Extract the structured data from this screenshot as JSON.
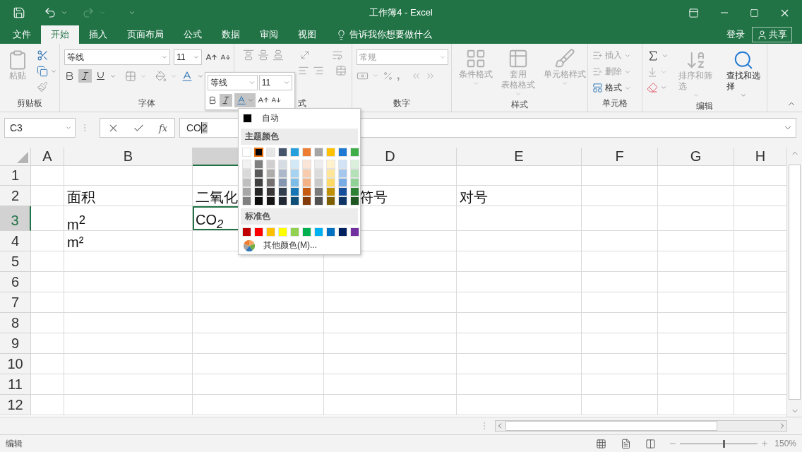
{
  "title_bar": {
    "title": "工作簿4 - Excel"
  },
  "menu_tabs": [
    {
      "label": "文件",
      "selected": false
    },
    {
      "label": "开始",
      "selected": true
    },
    {
      "label": "插入",
      "selected": false
    },
    {
      "label": "页面布局",
      "selected": false
    },
    {
      "label": "公式",
      "selected": false
    },
    {
      "label": "数据",
      "selected": false
    },
    {
      "label": "审阅",
      "selected": false
    },
    {
      "label": "视图",
      "selected": false
    }
  ],
  "tell_me": "告诉我你想要做什么",
  "account": {
    "sign_in": "登录",
    "share": "共享"
  },
  "ribbon": {
    "clipboard": {
      "paste": "粘贴",
      "label": "剪贴板"
    },
    "font": {
      "font_name": "等线",
      "font_size": "11",
      "italic_pressed": true,
      "label": "字体"
    },
    "alignment": {
      "label": "式",
      "disabled": true
    },
    "number": {
      "format": "常规",
      "comma": ",",
      "label": "数字",
      "disabled": true
    },
    "styles": {
      "items": [
        {
          "lines": [
            "条件格式"
          ],
          "disabled": true
        },
        {
          "lines": [
            "套用",
            "表格格式"
          ],
          "disabled": true
        },
        {
          "lines": [
            "单元格样式"
          ],
          "disabled": true
        }
      ],
      "label": "样式"
    },
    "cells": {
      "items": [
        {
          "label": "插入",
          "disabled": true
        },
        {
          "label": "删除",
          "disabled": true
        },
        {
          "label": "格式",
          "disabled": false
        }
      ],
      "label": "单元格"
    },
    "editing": {
      "sort": {
        "label": "排序和筛选",
        "disabled": true
      },
      "find": {
        "label": "查找和选择",
        "disabled": false
      },
      "label": "编辑"
    }
  },
  "formula_bar": {
    "name_box": "C3",
    "function_symbol": "fx",
    "value": "CO",
    "selected_text": "2"
  },
  "sheet": {
    "columns": [
      {
        "label": "A",
        "selected": false
      },
      {
        "label": "B",
        "selected": false
      },
      {
        "selected": true
      },
      {
        "label": "D",
        "selected": false
      },
      {
        "label": "E",
        "selected": false
      },
      {
        "label": "F",
        "selected": false
      },
      {
        "label": "G",
        "selected": false
      },
      {
        "label": "H",
        "selected": false
      }
    ],
    "rows": [
      {
        "label": "1",
        "selected": false,
        "cells": [
          {
            "selected": false
          },
          {
            "selected": false
          },
          {
            "selected": false
          },
          {
            "selected": false
          },
          {
            "selected": false
          },
          {
            "selected": false
          },
          {
            "selected": false
          },
          {
            "selected": false
          }
        ]
      },
      {
        "label": "2",
        "selected": false,
        "cells": [
          {
            "selected": false
          },
          {
            "text": "面积",
            "selected": false
          },
          {
            "text": "二氧化",
            "selected": false
          },
          {
            "text": "符号",
            "selected": false
          },
          {
            "text": "对号",
            "selected": false
          },
          {
            "selected": false
          },
          {
            "selected": false
          },
          {
            "selected": false
          }
        ]
      },
      {
        "label": "3",
        "selected": true,
        "cells": [
          {
            "selected": false
          },
          {
            "text": "m$^{2}$",
            "selected": false
          },
          {
            "text": "CO$_{2}$",
            "selected": true
          },
          {
            "selected": false
          },
          {
            "selected": false
          },
          {
            "selected": false
          },
          {
            "selected": false
          },
          {
            "selected": false
          }
        ]
      },
      {
        "label": "4",
        "selected": false,
        "cells": [
          {
            "selected": false
          },
          {
            "text": "m²",
            "selected": false
          },
          {
            "selected": false
          },
          {
            "selected": false
          },
          {
            "selected": false
          },
          {
            "selected": false
          },
          {
            "selected": false
          },
          {
            "selected": false
          }
        ]
      },
      {
        "label": "5",
        "selected": false,
        "cells": [
          {
            "selected": false
          },
          {
            "selected": false
          },
          {
            "selected": false
          },
          {
            "selected": false
          },
          {
            "selected": false
          },
          {
            "selected": false
          },
          {
            "selected": false
          },
          {
            "selected": false
          }
        ]
      },
      {
        "label": "6",
        "selected": false,
        "cells": [
          {
            "selected": false
          },
          {
            "selected": false
          },
          {
            "selected": false
          },
          {
            "selected": false
          },
          {
            "selected": false
          },
          {
            "selected": false
          },
          {
            "selected": false
          },
          {
            "selected": false
          }
        ]
      },
      {
        "label": "7",
        "selected": false,
        "cells": [
          {
            "selected": false
          },
          {
            "selected": false
          },
          {
            "selected": false
          },
          {
            "selected": false
          },
          {
            "selected": false
          },
          {
            "selected": false
          },
          {
            "selected": false
          },
          {
            "selected": false
          }
        ]
      },
      {
        "label": "8",
        "selected": false,
        "cells": [
          {
            "selected": false
          },
          {
            "selected": false
          },
          {
            "selected": false
          },
          {
            "selected": false
          },
          {
            "selected": false
          },
          {
            "selected": false
          },
          {
            "selected": false
          },
          {
            "selected": false
          }
        ]
      },
      {
        "label": "9",
        "selected": false,
        "cells": [
          {
            "selected": false
          },
          {
            "selected": false
          },
          {
            "selected": false
          },
          {
            "selected": false
          },
          {
            "selected": false
          },
          {
            "selected": false
          },
          {
            "selected": false
          },
          {
            "selected": false
          }
        ]
      },
      {
        "label": "10",
        "selected": false,
        "cells": [
          {
            "selected": false
          },
          {
            "selected": false
          },
          {
            "selected": false
          },
          {
            "selected": false
          },
          {
            "selected": false
          },
          {
            "selected": false
          },
          {
            "selected": false
          },
          {
            "selected": false
          }
        ]
      },
      {
        "label": "11",
        "selected": false,
        "cells": [
          {
            "selected": false
          },
          {
            "selected": false
          },
          {
            "selected": false
          },
          {
            "selected": false
          },
          {
            "selected": false
          },
          {
            "selected": false
          },
          {
            "selected": false
          },
          {
            "selected": false
          }
        ]
      },
      {
        "label": "12",
        "selected": false,
        "cells": [
          {
            "selected": false
          },
          {
            "selected": false
          },
          {
            "selected": false
          },
          {
            "selected": false
          },
          {
            "selected": false
          },
          {
            "selected": false
          },
          {
            "selected": false
          },
          {
            "selected": false
          }
        ]
      }
    ]
  },
  "mini_toolbar": {
    "font_name": "等线",
    "font_size": "11",
    "italic_pressed": true,
    "font_color_pressed": true
  },
  "color_menu": {
    "automatic": "自动",
    "theme_heading": "主题颜色",
    "theme_colors": [
      {
        "color": "#ffffff",
        "selected": false,
        "shades": [
          {
            "color": "#f2f2f2"
          },
          {
            "color": "#d9d9d9"
          },
          {
            "color": "#bfbfbf"
          },
          {
            "color": "#a6a6a6"
          },
          {
            "color": "#808080"
          }
        ]
      },
      {
        "color": "#000000",
        "selected": true,
        "shades": [
          {
            "color": "#808080"
          },
          {
            "color": "#595959"
          },
          {
            "color": "#404040"
          },
          {
            "color": "#262626"
          },
          {
            "color": "#0d0d0d"
          }
        ]
      },
      {
        "color": "#e7e6e6",
        "selected": false,
        "shades": [
          {
            "color": "#d0cece"
          },
          {
            "color": "#aeabab"
          },
          {
            "color": "#757171"
          },
          {
            "color": "#3a3838"
          },
          {
            "color": "#171616"
          }
        ]
      },
      {
        "color": "#44546a",
        "selected": false,
        "shades": [
          {
            "color": "#d6dce4"
          },
          {
            "color": "#adb9ca"
          },
          {
            "color": "#8496b0"
          },
          {
            "color": "#323f4f"
          },
          {
            "color": "#222a35"
          }
        ]
      },
      {
        "color": "#26a0da",
        "selected": false,
        "shades": [
          {
            "color": "#d3e9f7"
          },
          {
            "color": "#a8d3f0"
          },
          {
            "color": "#7dbde8"
          },
          {
            "color": "#1777b4"
          },
          {
            "color": "#0f4f78"
          }
        ]
      },
      {
        "color": "#ed7d31",
        "selected": false,
        "shades": [
          {
            "color": "#fbe5d6"
          },
          {
            "color": "#f8cbad"
          },
          {
            "color": "#f4b183"
          },
          {
            "color": "#c55a11"
          },
          {
            "color": "#843c0c"
          }
        ]
      },
      {
        "color": "#a5a5a5",
        "selected": false,
        "shades": [
          {
            "color": "#ededed"
          },
          {
            "color": "#dbdbdb"
          },
          {
            "color": "#c9c9c9"
          },
          {
            "color": "#7b7b7b"
          },
          {
            "color": "#525252"
          }
        ]
      },
      {
        "color": "#ffc000",
        "selected": false,
        "shades": [
          {
            "color": "#fff2cc"
          },
          {
            "color": "#ffe699"
          },
          {
            "color": "#ffd966"
          },
          {
            "color": "#bf9000"
          },
          {
            "color": "#7f6000"
          }
        ]
      },
      {
        "color": "#1f78d1",
        "selected": false,
        "shades": [
          {
            "color": "#d2e3f6"
          },
          {
            "color": "#a5c7ee"
          },
          {
            "color": "#79abe5"
          },
          {
            "color": "#174f9b"
          },
          {
            "color": "#0f3466"
          }
        ]
      },
      {
        "color": "#3fae49",
        "selected": false,
        "shades": [
          {
            "color": "#daf0db"
          },
          {
            "color": "#b5e1b8"
          },
          {
            "color": "#91d296"
          },
          {
            "color": "#2e8234"
          },
          {
            "color": "#1f5723"
          }
        ]
      }
    ],
    "standard_heading": "标准色",
    "standard_colors": [
      {
        "color": "#c00000"
      },
      {
        "color": "#ff0000"
      },
      {
        "color": "#ffc000"
      },
      {
        "color": "#ffff00"
      },
      {
        "color": "#92d050"
      },
      {
        "color": "#00b050"
      },
      {
        "color": "#00b0f0"
      },
      {
        "color": "#0070c0"
      },
      {
        "color": "#002060"
      },
      {
        "color": "#7030a0"
      }
    ],
    "more_colors": "其他颜色(M)..."
  },
  "status_bar": {
    "mode": "编辑",
    "zoom": "150%",
    "zoom_slider": {
      "level": 0.56
    }
  }
}
